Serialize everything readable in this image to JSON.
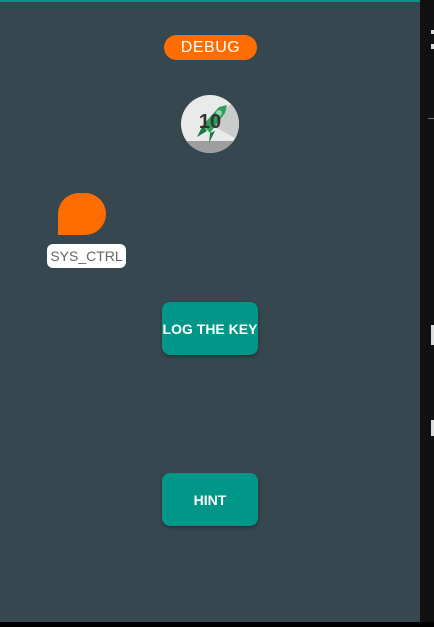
{
  "badge_debug": "DEBUG",
  "level_badge": {
    "number": "10"
  },
  "sys_ctrl_label": "SYS_CTRL",
  "buttons": {
    "log_the_key": "LOG THE KEY",
    "hint": "HINT"
  },
  "colors": {
    "background": "#37474f",
    "accent": "#009688",
    "orange": "#ff6d00"
  }
}
